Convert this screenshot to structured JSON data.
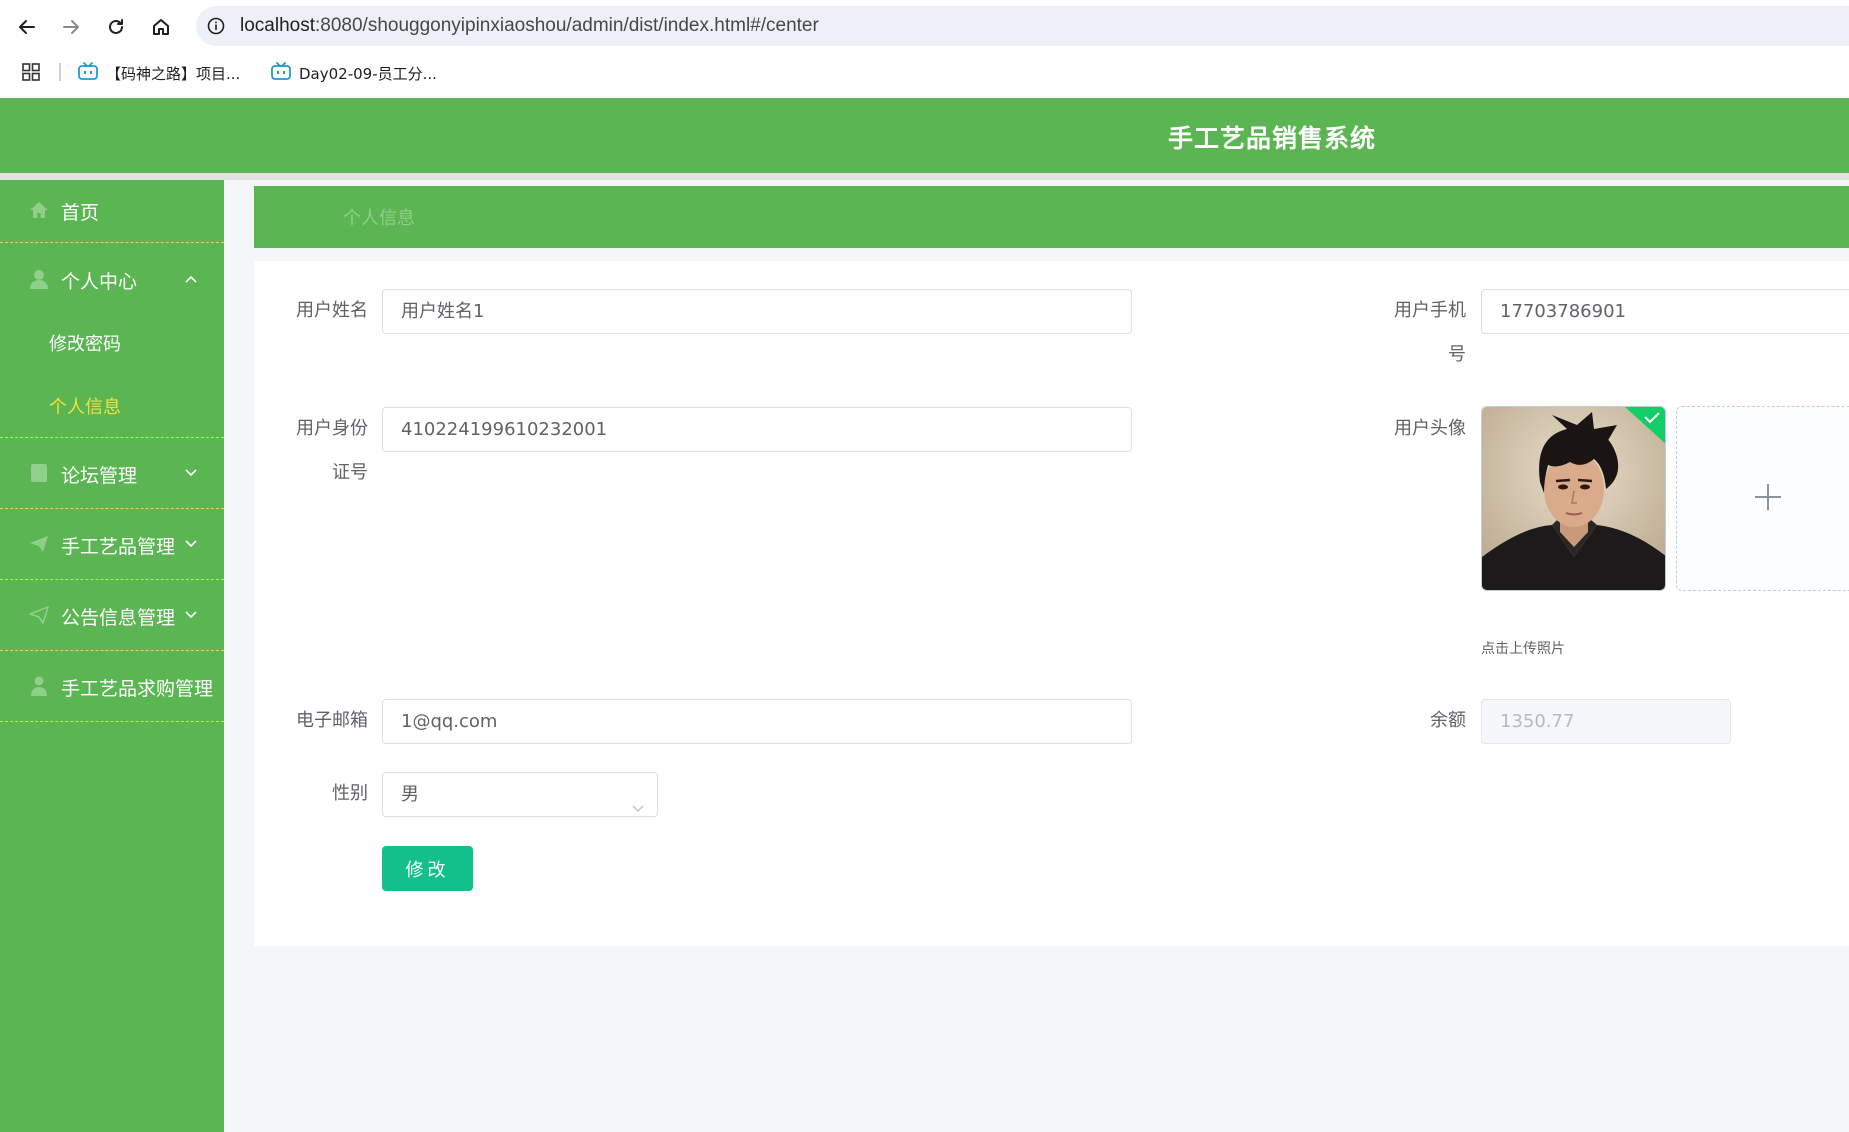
{
  "browser": {
    "url_host": "localhost",
    "url_rest": ":8080/shouggonyipinxiaoshou/admin/dist/index.html#/center",
    "bookmarks": [
      "【码神之路】项目...",
      "Day02-09-员工分..."
    ]
  },
  "app": {
    "title": "手工艺品销售系统"
  },
  "sidebar": {
    "home": "首页",
    "personal_center": "个人中心",
    "sub_change_password": "修改密码",
    "sub_personal_info": "个人信息",
    "forum": "论坛管理",
    "crafts": "手工艺品管理",
    "notices": "公告信息管理",
    "purchase": "手工艺品求购管理"
  },
  "breadcrumb": {
    "current": "个人信息"
  },
  "form": {
    "username_label": "用户姓名",
    "username_value": "用户姓名1",
    "phone_label_line1": "用户手机",
    "phone_label_line2": "号",
    "phone_value": "17703786901",
    "idcard_label_line1": "用户身份",
    "idcard_label_line2": "证号",
    "idcard_value": "410224199610232001",
    "avatar_label": "用户头像",
    "upload_tip": "点击上传照片",
    "email_label": "电子邮箱",
    "email_value": "1@qq.com",
    "balance_label": "余额",
    "balance_value": "1350.77",
    "gender_label": "性别",
    "gender_value": "男",
    "submit_label": "修改"
  },
  "colors": {
    "theme_green": "#5ab552",
    "active_submenu": "#f0e040",
    "button_teal": "#13c08c"
  }
}
